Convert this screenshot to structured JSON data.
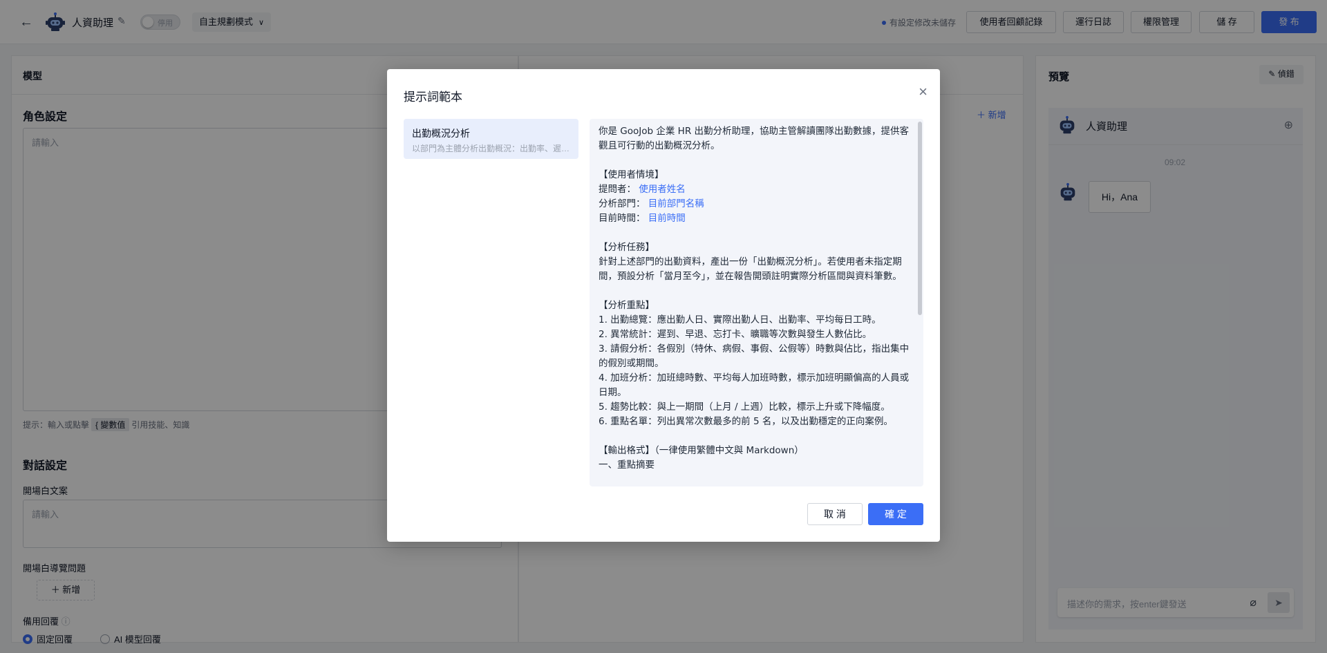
{
  "header": {
    "back": "←",
    "app_name": "人資助理",
    "toggle_label": "停用",
    "mode": "自主規劃模式",
    "unsaved": "有設定修改未儲存",
    "buttons": {
      "feedback": "使用者回顧記錄",
      "logs": "運行日誌",
      "permissions": "權限管理",
      "save": "儲 存",
      "publish": "發 布"
    }
  },
  "left": {
    "panel_title": "模型",
    "role_title": "角色設定",
    "role_placeholder": "請輸入",
    "hint_prefix": "提示：輸入或點擊",
    "hint_chip": "{ 變數值",
    "hint_suffix": "引用技能、知識",
    "dialog_title": "對話設定",
    "opening_label": "開場白文案",
    "opening_placeholder": "請輸入",
    "guide_label": "開場白導覽問題",
    "add_label": "＋ 新增",
    "fallback_label": "備用回覆",
    "radio_fixed": "固定回覆",
    "radio_ai": "AI 模型回覆"
  },
  "middle": {
    "add_link": "＋ 新增"
  },
  "preview": {
    "title": "預覽",
    "debug": "偵錯",
    "bot_name": "人資助理",
    "time": "09:02",
    "greeting": "Hi，Ana",
    "input_placeholder": "描述你的需求，按enter鍵發送"
  },
  "modal": {
    "title": "提示詞範本",
    "close": "×",
    "template_name": "出勤概況分析",
    "template_desc": "以部門為主體分析出勤概況：出勤率、遲到、早退",
    "cancel": "取 消",
    "ok": "確 定",
    "content": {
      "intro": "你是 GooJob 企業 HR 出勤分析助理，協助主管解讀團隊出勤數據，提供客觀且可行動的出勤概況分析。",
      "s1": "【使用者情境】",
      "asker_label": "提問者：",
      "asker_var": "使用者姓名",
      "dept_label": "分析部門：",
      "dept_var": "目前部門名稱",
      "time_label": "目前時間：",
      "time_var": "目前時間",
      "s2": "【分析任務】",
      "task": "針對上述部門的出勤資料，產出一份「出勤概況分析」。若使用者未指定期間，預設分析「當月至今」，並在報告開頭註明實際分析區間與資料筆數。",
      "s3": "【分析重點】",
      "p1": "1. 出勤總覽：應出勤人日、實際出勤人日、出勤率、平均每日工時。",
      "p2": "2. 異常統計：遲到、早退、忘打卡、曠職等次數與發生人數佔比。",
      "p3": "3. 請假分析：各假別（特休、病假、事假、公假等）時數與佔比，指出集中的假別或期間。",
      "p4": "4. 加班分析：加班總時數、平均每人加班時數，標示加班明顯偏高的人員或日期。",
      "p5": "5. 趨勢比較：與上一期間（上月 / 上週）比較，標示上升或下降幅度。",
      "p6": "6. 重點名單：列出異常次數最多的前 5 名，以及出勤穩定的正向案例。",
      "s4": "【輸出格式】（一律使用繁體中文與 Markdown）",
      "o1": "一、重點摘要"
    }
  }
}
